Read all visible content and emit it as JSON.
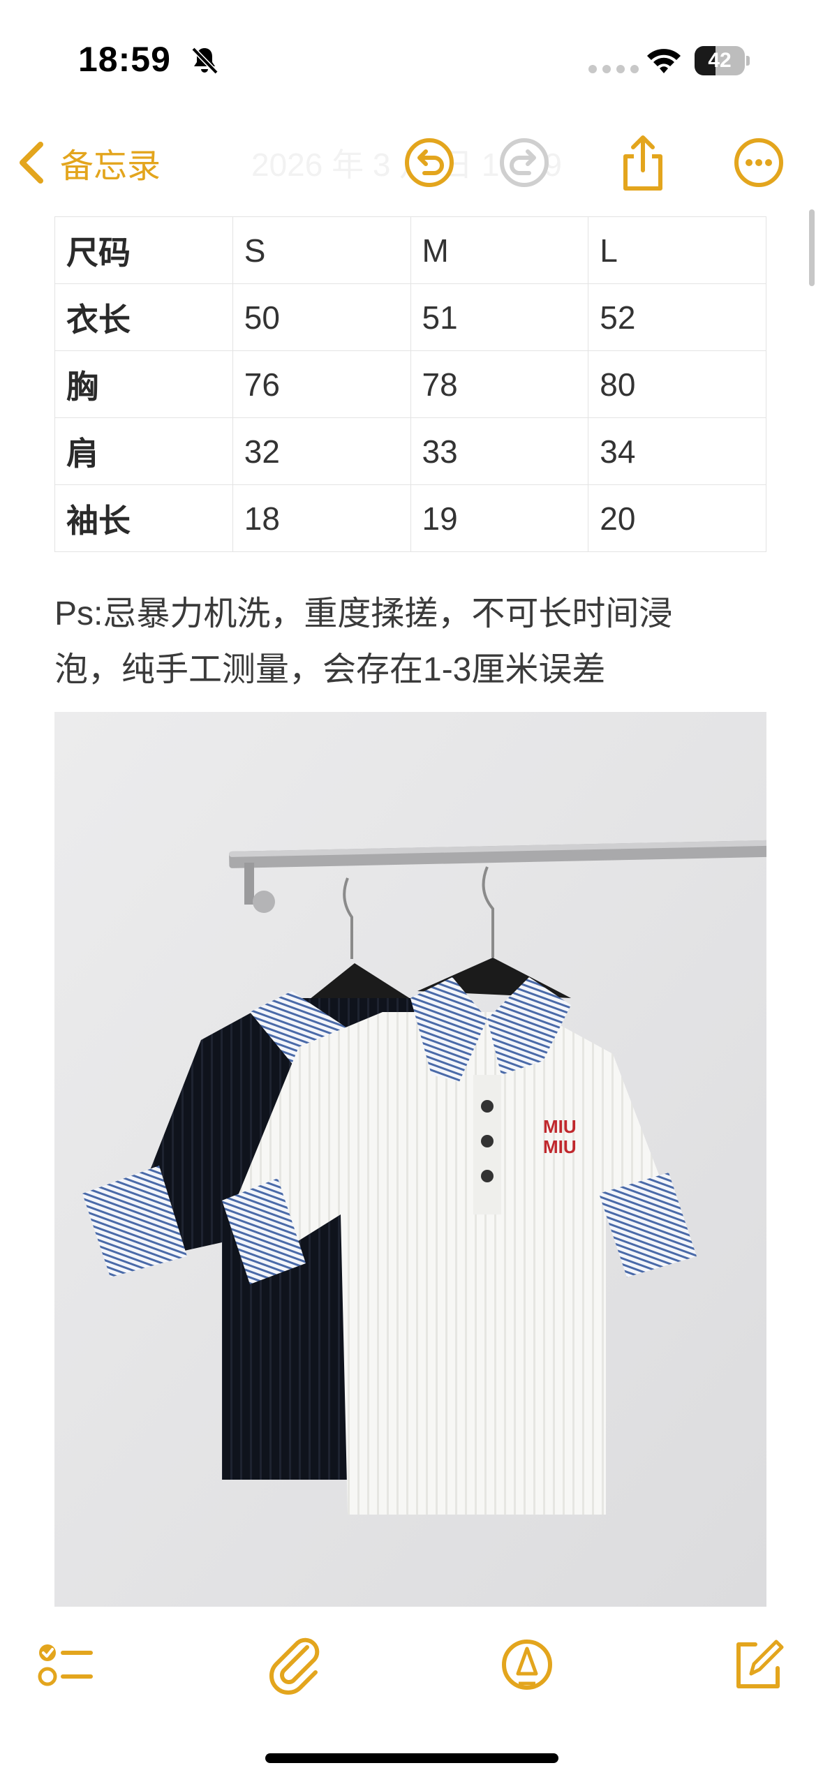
{
  "status_bar": {
    "time": "18:59",
    "battery_level": "42",
    "icons": [
      "bell-slash-icon",
      "cellular-signal-icon",
      "wifi-icon",
      "battery-icon"
    ]
  },
  "nav": {
    "back_label": "备忘录",
    "date_text": "2026 年 3 月 日 18:59",
    "buttons": [
      "undo-icon",
      "redo-icon",
      "share-icon",
      "more-icon"
    ]
  },
  "size_table": {
    "rows": [
      [
        "尺码",
        "S",
        "M",
        "L"
      ],
      [
        "衣长",
        "50",
        "51",
        "52"
      ],
      [
        "胸",
        "76",
        "78",
        "80"
      ],
      [
        "肩",
        "32",
        "33",
        "34"
      ],
      [
        "袖长",
        "18",
        "19",
        "20"
      ]
    ]
  },
  "note": {
    "line1": "Ps:忌暴力机洗，重度揉搓，不可长时间浸",
    "line2": "泡，纯手工测量，会存在1-3厘米误差"
  },
  "photo": {
    "logo_line1": "MIU",
    "logo_line2": "MIU"
  },
  "toolbar": {
    "buttons": [
      "checklist-icon",
      "paperclip-icon",
      "markup-pen-icon",
      "compose-icon"
    ]
  },
  "colors": {
    "accent": "#E3A51D",
    "text": "#333333",
    "border": "#E3E3E3"
  }
}
